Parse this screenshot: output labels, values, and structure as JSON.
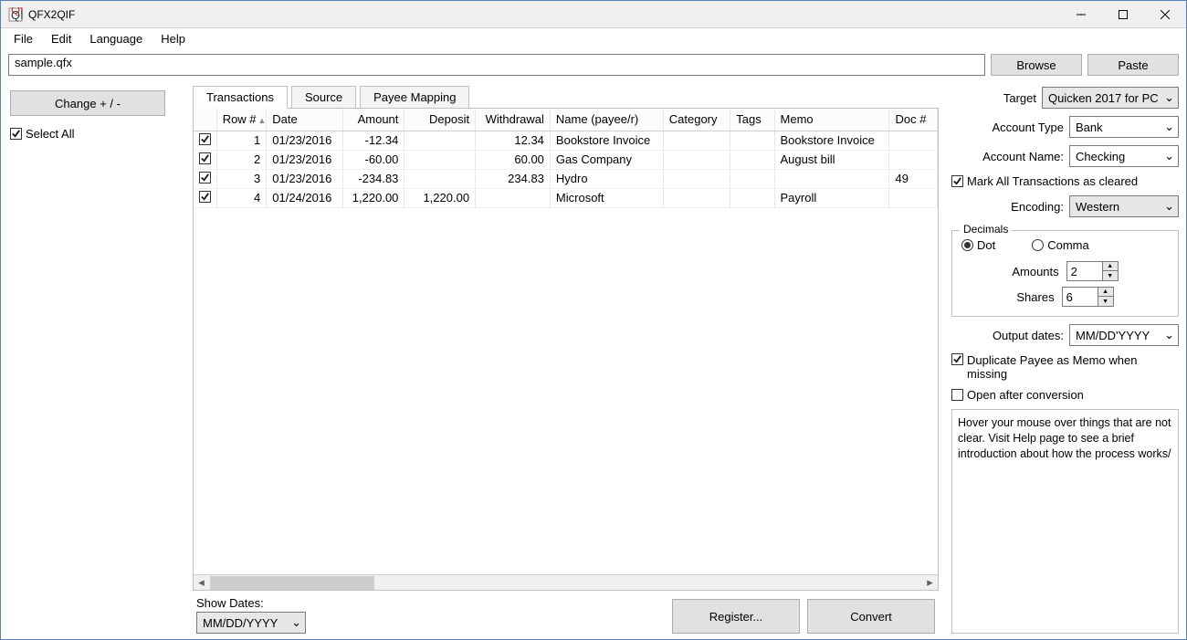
{
  "window_title": "QFX2QIF",
  "menu": {
    "file": "File",
    "edit": "Edit",
    "language": "Language",
    "help": "Help"
  },
  "filepath": "sample.qfx",
  "browse_label": "Browse",
  "paste_label": "Paste",
  "left": {
    "change_label": "Change + / -",
    "select_all_label": "Select All"
  },
  "tabs": {
    "transactions": "Transactions",
    "source": "Source",
    "payee_mapping": "Payee Mapping"
  },
  "columns": {
    "row": "Row #",
    "date": "Date",
    "amount": "Amount",
    "deposit": "Deposit",
    "withdrawal": "Withdrawal",
    "name": "Name (payee/r)",
    "category": "Category",
    "tags": "Tags",
    "memo": "Memo",
    "doc": "Doc #"
  },
  "rows": [
    {
      "row": "1",
      "date": "01/23/2016",
      "amount": "-12.34",
      "deposit": "",
      "withdrawal": "12.34",
      "name": "Bookstore Invoice",
      "category": "",
      "tags": "",
      "memo": "Bookstore Invoice",
      "doc": ""
    },
    {
      "row": "2",
      "date": "01/23/2016",
      "amount": "-60.00",
      "deposit": "",
      "withdrawal": "60.00",
      "name": "Gas Company",
      "category": "",
      "tags": "",
      "memo": "August bill",
      "doc": ""
    },
    {
      "row": "3",
      "date": "01/23/2016",
      "amount": "-234.83",
      "deposit": "",
      "withdrawal": "234.83",
      "name": "Hydro",
      "category": "",
      "tags": "",
      "memo": "",
      "doc": "49"
    },
    {
      "row": "4",
      "date": "01/24/2016",
      "amount": "1,220.00",
      "deposit": "1,220.00",
      "withdrawal": "",
      "name": "Microsoft",
      "category": "",
      "tags": "",
      "memo": "Payroll",
      "doc": ""
    }
  ],
  "show_dates_label": "Show Dates:",
  "show_dates_value": "MM/DD/YYYY",
  "register_label": "Register...",
  "convert_label": "Convert",
  "right": {
    "target_label": "Target",
    "target_value": "Quicken 2017 for PC",
    "account_type_label": "Account Type",
    "account_type_value": "Bank",
    "account_name_label": "Account Name:",
    "account_name_value": "Checking",
    "mark_cleared_label": "Mark All Transactions as cleared",
    "encoding_label": "Encoding:",
    "encoding_value": "Western",
    "decimals_group": "Decimals",
    "dot_label": "Dot",
    "comma_label": "Comma",
    "amounts_label": "Amounts",
    "amounts_value": "2",
    "shares_label": "Shares",
    "shares_value": "6",
    "output_dates_label": "Output dates:",
    "output_dates_value": "MM/DD'YYYY",
    "dup_payee_label": "Duplicate Payee as Memo when missing",
    "open_after_label": "Open after conversion",
    "hint": "Hover your mouse over things that are not clear. Visit Help page to see a brief introduction about how the process works/"
  }
}
